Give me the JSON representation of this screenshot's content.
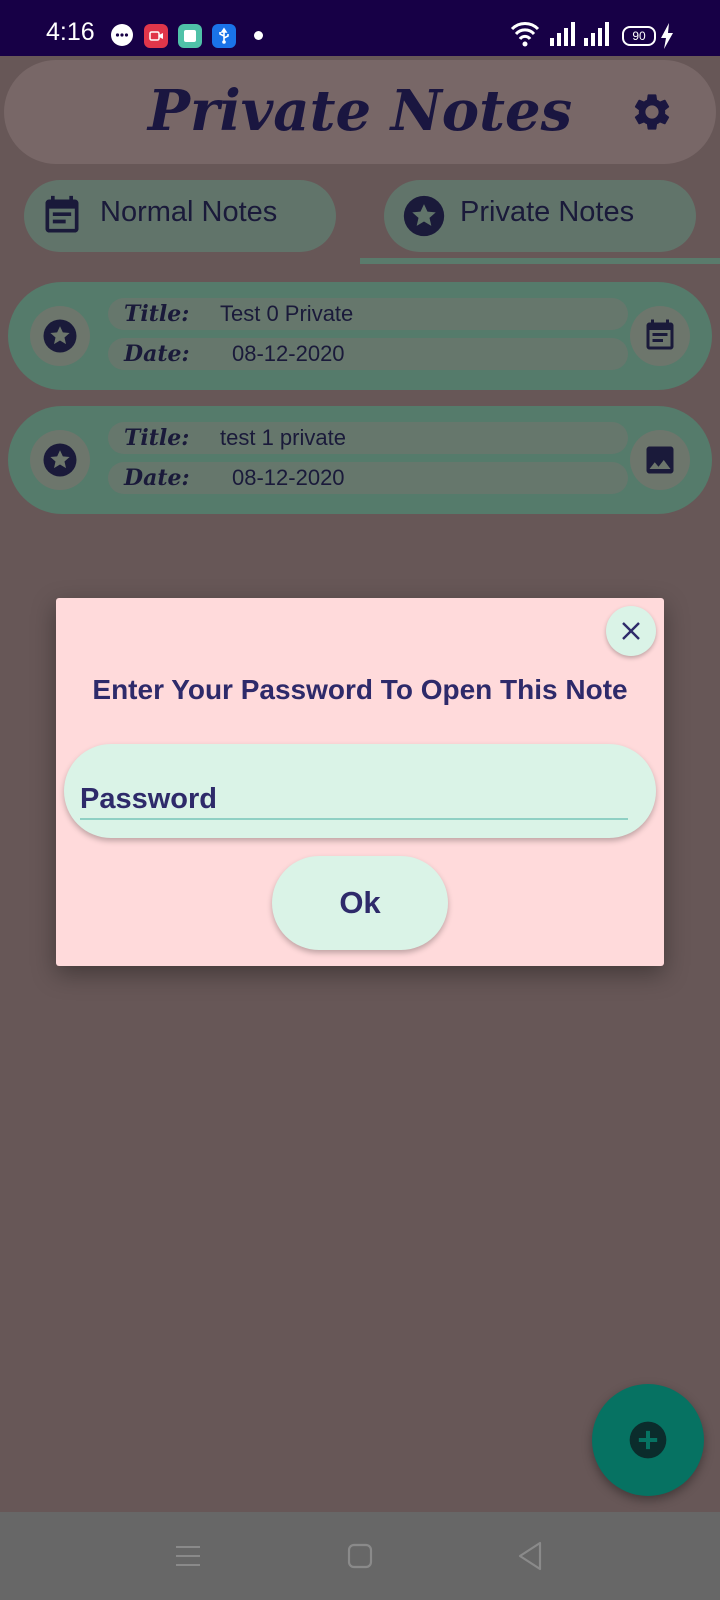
{
  "status_bar": {
    "time": "4:16",
    "battery": "90",
    "notification_icons": [
      "chat-bubble-icon",
      "screen-record-icon",
      "app-icon",
      "usb-icon",
      "dot-icon"
    ],
    "system_icons": [
      "wifi-icon",
      "signal-icon",
      "signal-icon",
      "battery-icon",
      "charging-icon"
    ]
  },
  "app_bar": {
    "title": "Private Notes",
    "settings_icon": "gear-icon"
  },
  "tabs": [
    {
      "label": "Normal Notes",
      "icon": "calendar-note-icon",
      "selected": false
    },
    {
      "label": "Private Notes",
      "icon": "star-icon",
      "selected": true
    }
  ],
  "notes": [
    {
      "title_label": "Title:",
      "title": "Test 0 Private",
      "date_label": "Date:",
      "date": "08-12-2020",
      "type_icon": "note-icon"
    },
    {
      "title_label": "Title:",
      "title": "test 1 private",
      "date_label": "Date:",
      "date": "08-12-2020",
      "type_icon": "image-icon"
    }
  ],
  "dialog": {
    "title": "Enter Your Password To Open This Note",
    "password_placeholder": "Password",
    "password_value": "",
    "ok_label": "Ok",
    "close_icon": "close-icon"
  },
  "fab": {
    "icon": "add-icon"
  },
  "colors": {
    "status_bar": "#170046",
    "scrim_background": "#675757",
    "dialog_background": "#ffdadb",
    "mint": "#daf3e7",
    "accent_teal": "#067262",
    "text_dark": "#2e2a6a"
  }
}
